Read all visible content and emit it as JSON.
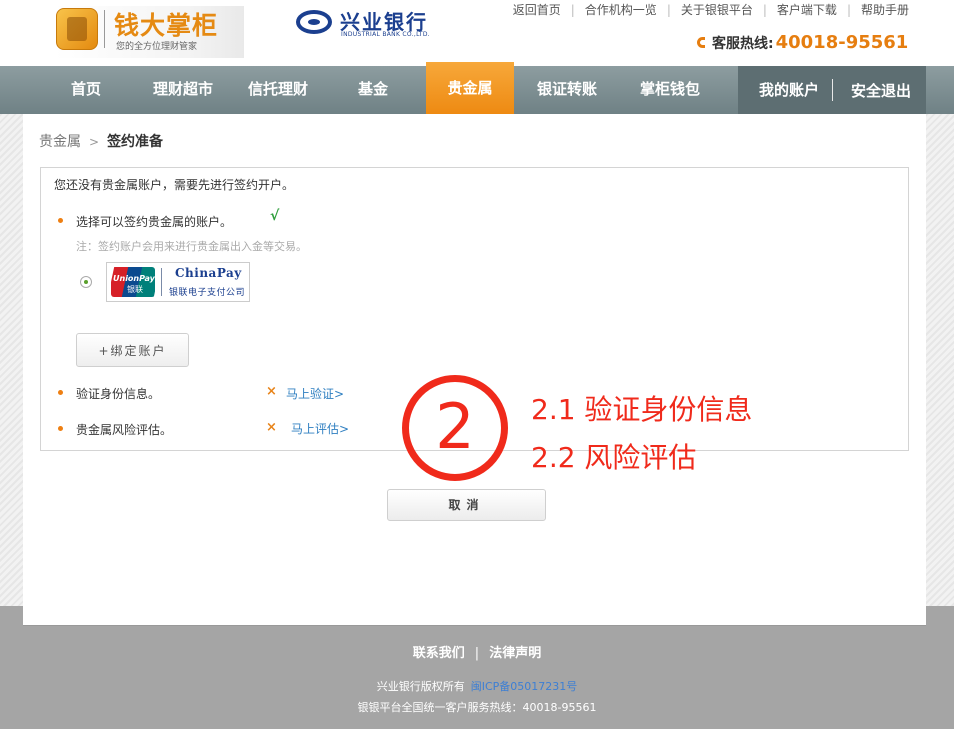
{
  "header": {
    "logo_name": "钱大掌柜",
    "logo_slogan": "您的全方位理财管家",
    "bank_name": "兴业银行",
    "bank_en": "INDUSTRIAL BANK CO.,LTD.",
    "top_links": [
      "返回首页",
      "合作机构一览",
      "关于银银平台",
      "客户端下载",
      "帮助手册"
    ],
    "hotline_label": "客服热线:",
    "hotline_number": "40018-95561"
  },
  "nav": {
    "items": [
      "首页",
      "理财超市",
      "信托理财",
      "基金",
      "贵金属",
      "银证转账",
      "掌柜钱包"
    ],
    "active": "贵金属",
    "my_account": "我的账户",
    "logout": "安全退出"
  },
  "breadcrumb": {
    "parent": "贵金属",
    "separator": ">",
    "current": "签约准备"
  },
  "content": {
    "notice": "您还没有贵金属账户，需要先进行签约开户。",
    "step1_label": "选择可以签约贵金属的账户。",
    "step1_status": "√",
    "step1_note": "注：签约账户会用来进行贵金属出入金等交易。",
    "account": {
      "unionpay_en": "UnionPay",
      "unionpay_cn": "银联",
      "chinapay_title": "ChinaPay",
      "chinapay_sub": "银联电子支付公司"
    },
    "bind_button": "+绑定账户",
    "step2_label": "验证身份信息。",
    "step2_status": "×",
    "step2_link": "马上验证>",
    "step3_label": "贵金属风险评估。",
    "step3_status": "×",
    "step3_link": "马上评估>",
    "cancel_button": "取消"
  },
  "annotation": {
    "number": "2",
    "line1": "2.1 验证身份信息",
    "line2": "2.2 风险评估",
    "color": "#f02a1b"
  },
  "footer": {
    "contact": "联系我们",
    "legal": "法律声明",
    "copyright": "兴业银行版权所有",
    "icp": "闽ICP备05017231号",
    "hotline_text": "银银平台全国统一客户服务热线：40018-95561"
  },
  "colors": {
    "nav_bg": "#7d8f93",
    "nav_active": "#f29a22",
    "accent_orange": "#e67e10",
    "link_blue": "#2f7fc1"
  }
}
